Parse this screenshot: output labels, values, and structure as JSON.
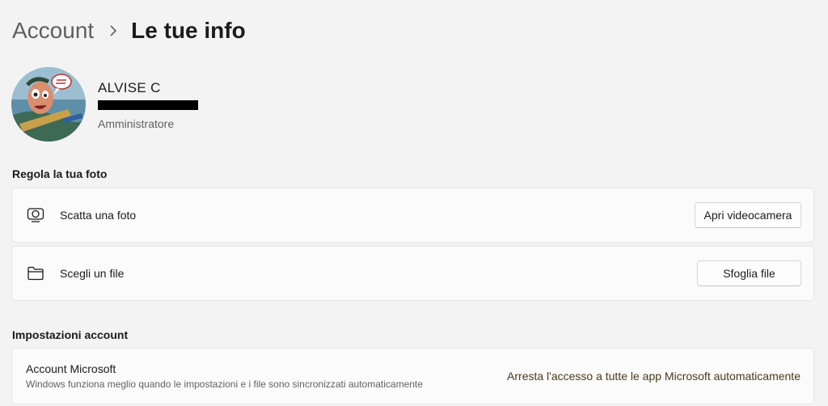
{
  "breadcrumb": {
    "parent": "Account",
    "current": "Le tue info"
  },
  "profile": {
    "name": "ALVISE C",
    "role": "Amministratore"
  },
  "photo_section": {
    "title": "Regola la tua foto",
    "take_photo": {
      "label": "Scatta una foto",
      "button": "Apri videocamera",
      "icon": "camera-icon"
    },
    "choose_file": {
      "label": "Scegli un file",
      "button": "Sfoglia file",
      "icon": "folder-icon"
    }
  },
  "account_section": {
    "title": "Impostazioni account",
    "microsoft_account": {
      "title": "Account Microsoft",
      "description": "Windows funziona meglio quando le impostazioni e i file sono sincronizzati automaticamente",
      "link": "Arresta l'accesso a tutte le app Microsoft automaticamente"
    }
  }
}
